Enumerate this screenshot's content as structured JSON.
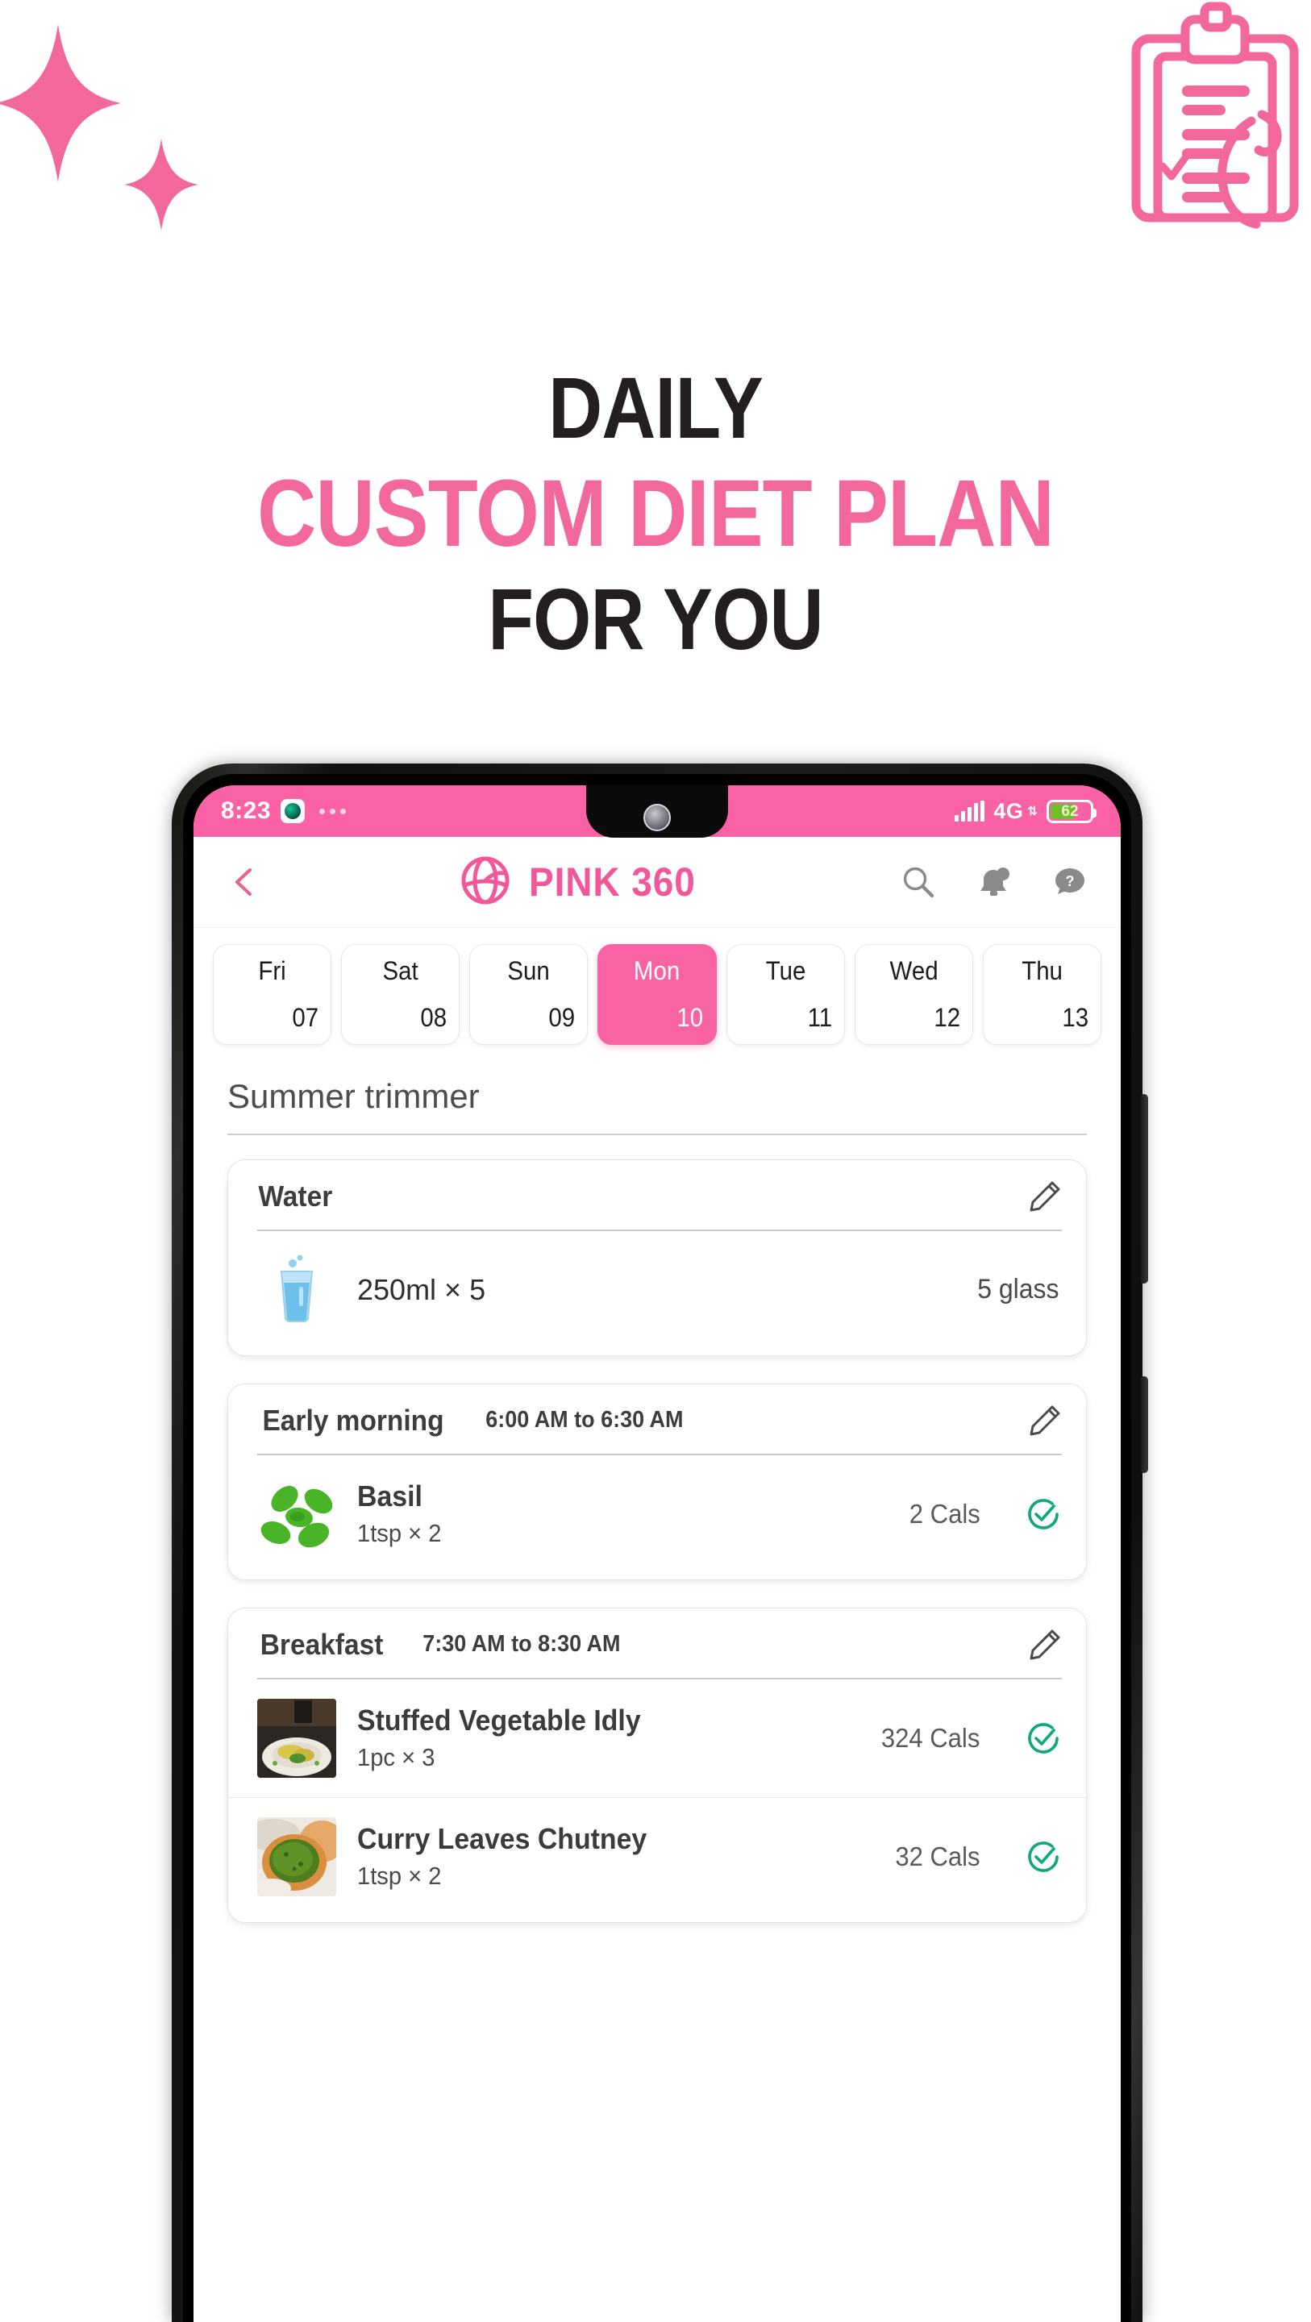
{
  "theme": {
    "pink": "#f2689c",
    "pink_dark": "#f2579a",
    "pink_status": "#fb61a5",
    "pink_selected": "#fa63a3",
    "black_text": "#231f20",
    "green_check": "#0fa87c"
  },
  "poster": {
    "headline": {
      "line1": "DAILY",
      "line2": "CUSTOM DIET PLAN",
      "line3": "FOR YOU"
    },
    "decor": {
      "sparkle_large": "sparkle-icon",
      "sparkle_small": "sparkle-icon",
      "clipboard": "clipboard-checklist-icon"
    }
  },
  "phone": {
    "status_bar": {
      "time": "8:23",
      "app_icon": "camera-app-icon",
      "overflow_dots": "more-dots-icon",
      "signal_icon": "signal-bars-icon",
      "network": "4G",
      "network_suffix": "lte-arrows-icon",
      "battery_percent": "62",
      "battery_icon": "battery-icon"
    },
    "app_bar": {
      "back_icon": "chevron-left-icon",
      "logo_icon": "globe-logo-icon",
      "brand": "PINK 360",
      "search_icon": "search-icon",
      "notification_icon": "bell-icon",
      "help_icon": "question-chat-icon"
    },
    "date_strip": {
      "days": [
        {
          "weekday": "Fri",
          "date": "07",
          "selected": false
        },
        {
          "weekday": "Sat",
          "date": "08",
          "selected": false
        },
        {
          "weekday": "Sun",
          "date": "09",
          "selected": false
        },
        {
          "weekday": "Mon",
          "date": "10",
          "selected": true
        },
        {
          "weekday": "Tue",
          "date": "11",
          "selected": false
        },
        {
          "weekday": "Wed",
          "date": "12",
          "selected": false
        },
        {
          "weekday": "Thu",
          "date": "13",
          "selected": false
        }
      ]
    },
    "plan": {
      "title": "Summer trimmer"
    },
    "water_card": {
      "title": "Water",
      "edit_icon": "pencil-icon",
      "glass_icon": "water-glass-icon",
      "amount": "250ml × 5",
      "total": "5 glass"
    },
    "meals": [
      {
        "name": "Early morning",
        "time": "6:00 AM to 6:30 AM",
        "edit_icon": "pencil-icon",
        "items": [
          {
            "thumb": "basil-leaves-image",
            "name": "Basil",
            "qty": "1tsp × 2",
            "calories": "2 Cals",
            "check_icon": "check-circle-icon"
          }
        ]
      },
      {
        "name": "Breakfast",
        "time": "7:30 AM to 8:30 AM",
        "edit_icon": "pencil-icon",
        "items": [
          {
            "thumb": "stuffed-idly-image",
            "name": "Stuffed Vegetable Idly",
            "qty": "1pc × 3",
            "calories": "324 Cals",
            "check_icon": "check-circle-icon"
          },
          {
            "thumb": "curry-chutney-image",
            "name": "Curry Leaves Chutney",
            "qty": "1tsp × 2",
            "calories": "32 Cals",
            "check_icon": "check-circle-icon"
          }
        ]
      }
    ]
  }
}
